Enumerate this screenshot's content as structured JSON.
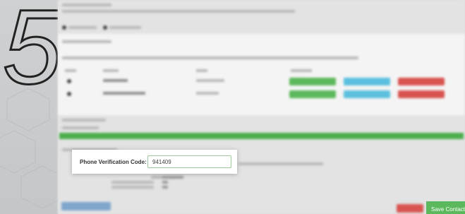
{
  "wizard": {
    "step_number": "5"
  },
  "verification": {
    "label": "Phone Verification Code:",
    "value": "941409"
  },
  "actions": {
    "save_label": "Save Contact"
  },
  "colors": {
    "accent_green": "#5cb85c",
    "info_blue": "#5bc0de",
    "danger_red": "#d9534f"
  }
}
